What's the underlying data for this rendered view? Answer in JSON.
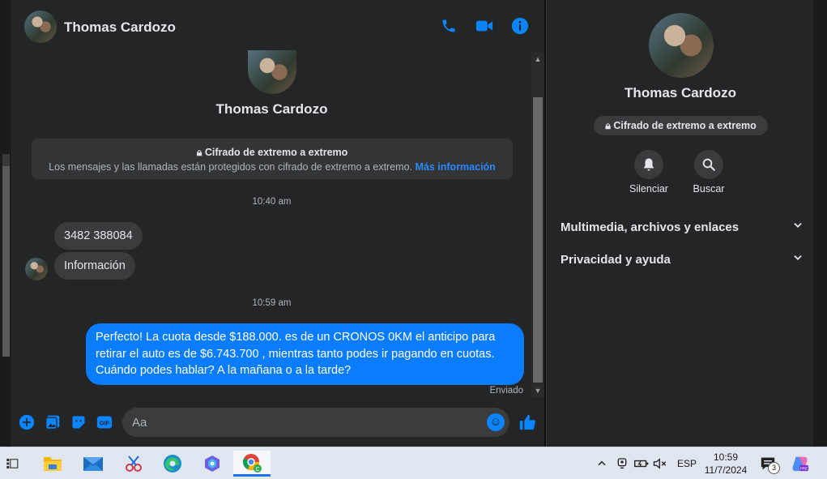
{
  "contact": {
    "name": "Thomas Cardozo"
  },
  "header": {
    "call_icon": "phone-icon",
    "video_icon": "video-icon",
    "info_icon": "info-icon"
  },
  "encryption": {
    "title": "Cifrado de extremo a extremo",
    "text": "Los mensajes y las llamadas están protegidos con cifrado de extremo a extremo.",
    "link": "Más información"
  },
  "messages": {
    "time1": "10:40 am",
    "incoming": [
      "3482 388084",
      "Información"
    ],
    "time2": "10:59 am",
    "outgoing": "Perfecto! La cuota desde $188.000. es de un CRONOS 0KM el anticipo para retirar el auto es de $6.743.700 , mientras tanto podes ir pagando en cuotas. Cuándo podes hablar? A la mañana o a la tarde?",
    "status": "Enviado"
  },
  "composer": {
    "placeholder": "Aa"
  },
  "sidebar": {
    "encryption_badge": "Cifrado de extremo a extremo",
    "mute_label": "Silenciar",
    "search_label": "Buscar",
    "sections": [
      "Multimedia, archivos y enlaces",
      "Privacidad y ayuda"
    ]
  },
  "taskbar": {
    "language": "ESP",
    "time": "10:59",
    "date": "11/7/2024",
    "notification_count": "3"
  },
  "colors": {
    "accent": "#0a84ff",
    "bubble_out": "#0a7cff",
    "background": "#242526"
  }
}
